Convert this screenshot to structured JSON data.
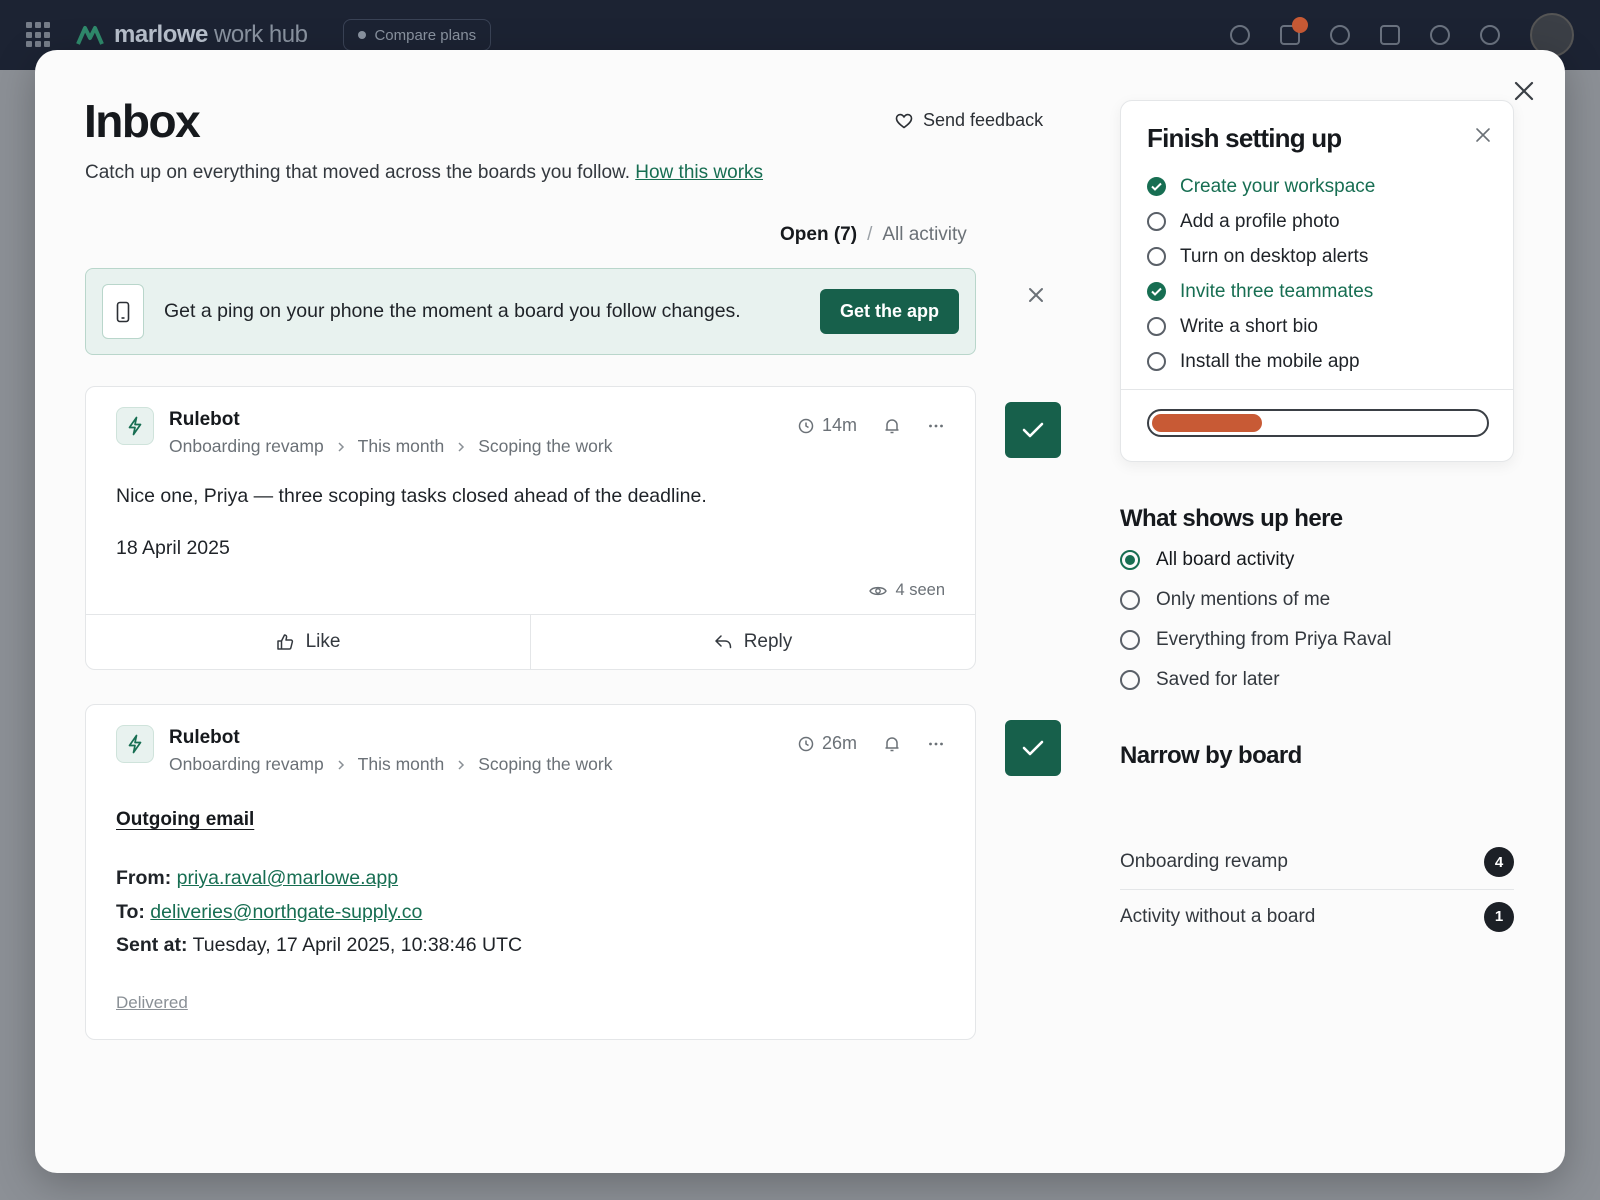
{
  "appbar": {
    "brand_bold": "marlowe",
    "brand_light": "work hub",
    "compare_label": "Compare plans"
  },
  "inbox": {
    "title": "Inbox",
    "feedback_label": "Send feedback",
    "subtitle": "Catch up on everything that moved across the boards you follow.",
    "subtitle_link": "How this works",
    "tabs": {
      "open": "Open (7)",
      "separator": "/",
      "all": "All activity"
    }
  },
  "banner": {
    "text": "Get a ping on your phone the moment a board you follow changes.",
    "button": "Get the app"
  },
  "cards": [
    {
      "author": "Rulebot",
      "crumbs": [
        "Onboarding revamp",
        "This month",
        "Scoping the work"
      ],
      "time": "14m",
      "body": "Nice one, Priya — three scoping tasks closed ahead of the deadline.",
      "date": "18 April 2025",
      "seen": "4 seen",
      "like": "Like",
      "reply": "Reply"
    },
    {
      "author": "Rulebot",
      "crumbs": [
        "Onboarding revamp",
        "This month",
        "Scoping the work"
      ],
      "time": "26m",
      "mail_title": "Outgoing email",
      "from_label": "From:",
      "from": "priya.raval@marlowe.app",
      "to_label": "To:",
      "to": "deliveries@northgate-supply.co",
      "sent_label": "Sent at:",
      "sent": "Tuesday, 17 April 2025, 10:38:46 UTC",
      "status": "Delivered"
    }
  ],
  "setup": {
    "title": "Finish setting up",
    "steps": [
      {
        "label": "Create your workspace",
        "done": true
      },
      {
        "label": "Add a profile photo",
        "done": false
      },
      {
        "label": "Turn on desktop alerts",
        "done": false
      },
      {
        "label": "Invite three teammates",
        "done": true
      },
      {
        "label": "Write a short bio",
        "done": false
      },
      {
        "label": "Install the mobile app",
        "done": false
      }
    ],
    "progress": 0.33
  },
  "filters": {
    "title": "What shows up here",
    "options": [
      "All board activity",
      "Only mentions of me",
      "Everything from Priya Raval",
      "Saved for later"
    ],
    "selected": "All board activity"
  },
  "boards": {
    "title": "Narrow by board",
    "items": [
      {
        "label": "Onboarding revamp",
        "count": "4"
      },
      {
        "label": "Activity without a board",
        "count": "1"
      }
    ]
  },
  "colors": {
    "accent": "#17604b",
    "progress": "#c85a35",
    "appbar": "#1c2333"
  }
}
